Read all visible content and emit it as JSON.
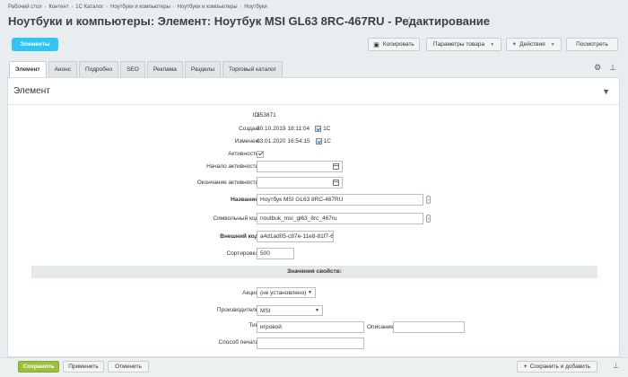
{
  "breadcrumb": [
    "Рабочий стол",
    "Контент",
    "1С Каталог",
    "Ноутбуки и компьютеры",
    "Ноутбуки и компьютеры",
    "Ноутбуки"
  ],
  "page_title": "Ноутбуки и компьютеры: Элемент: Ноутбук MSI GL63 8RC-467RU - Редактирование",
  "toolbar": {
    "elements": "Элементы",
    "copy": "Копировать",
    "product_params": "Параметры товара",
    "actions": "Действия",
    "actions_prefix": "+",
    "view": "Посмотреть"
  },
  "tabs": [
    "Элемент",
    "Анонс",
    "Подробно",
    "SEO",
    "Реклама",
    "Разделы",
    "Торговый каталог"
  ],
  "panel_title": "Элемент",
  "fields": {
    "id_label": "ID:",
    "id_value": "353871",
    "created_label": "Создан:",
    "created_value": "30.10.2019 18:11:04",
    "created_by": "1C",
    "changed_label": "Изменен:",
    "changed_value": "03.01.2020 16:54:15",
    "changed_by": "1C",
    "active_label": "Активность:",
    "active_from_label": "Начало активности:",
    "active_to_label": "Окончание активности:",
    "name_label": "Название:",
    "name_value": "Ноутбук MSI GL63 8RC-467RU",
    "code_label": "Символьный код:",
    "code_value": "noutbuk_msi_gl63_8rc_467ru",
    "xml_label": "Внешний код:",
    "xml_value": "a4d1ad05-c87e-11e8-81f7-6",
    "sort_label": "Сортировка:",
    "sort_value": "500"
  },
  "props": {
    "header": "Значения свойств:",
    "action_label": "Акция:",
    "action_value": "(не установлено)",
    "maker_label": "Производитель:",
    "maker_value": "MSI",
    "type_label": "Тип:",
    "type_value": "игровой",
    "desc_label": "Описание",
    "print_label": "Способ печати:"
  },
  "footer": {
    "save": "Сохранить",
    "apply": "Применить",
    "cancel": "Отменить",
    "save_add": "Сохранить и добавить",
    "save_add_prefix": "+"
  }
}
